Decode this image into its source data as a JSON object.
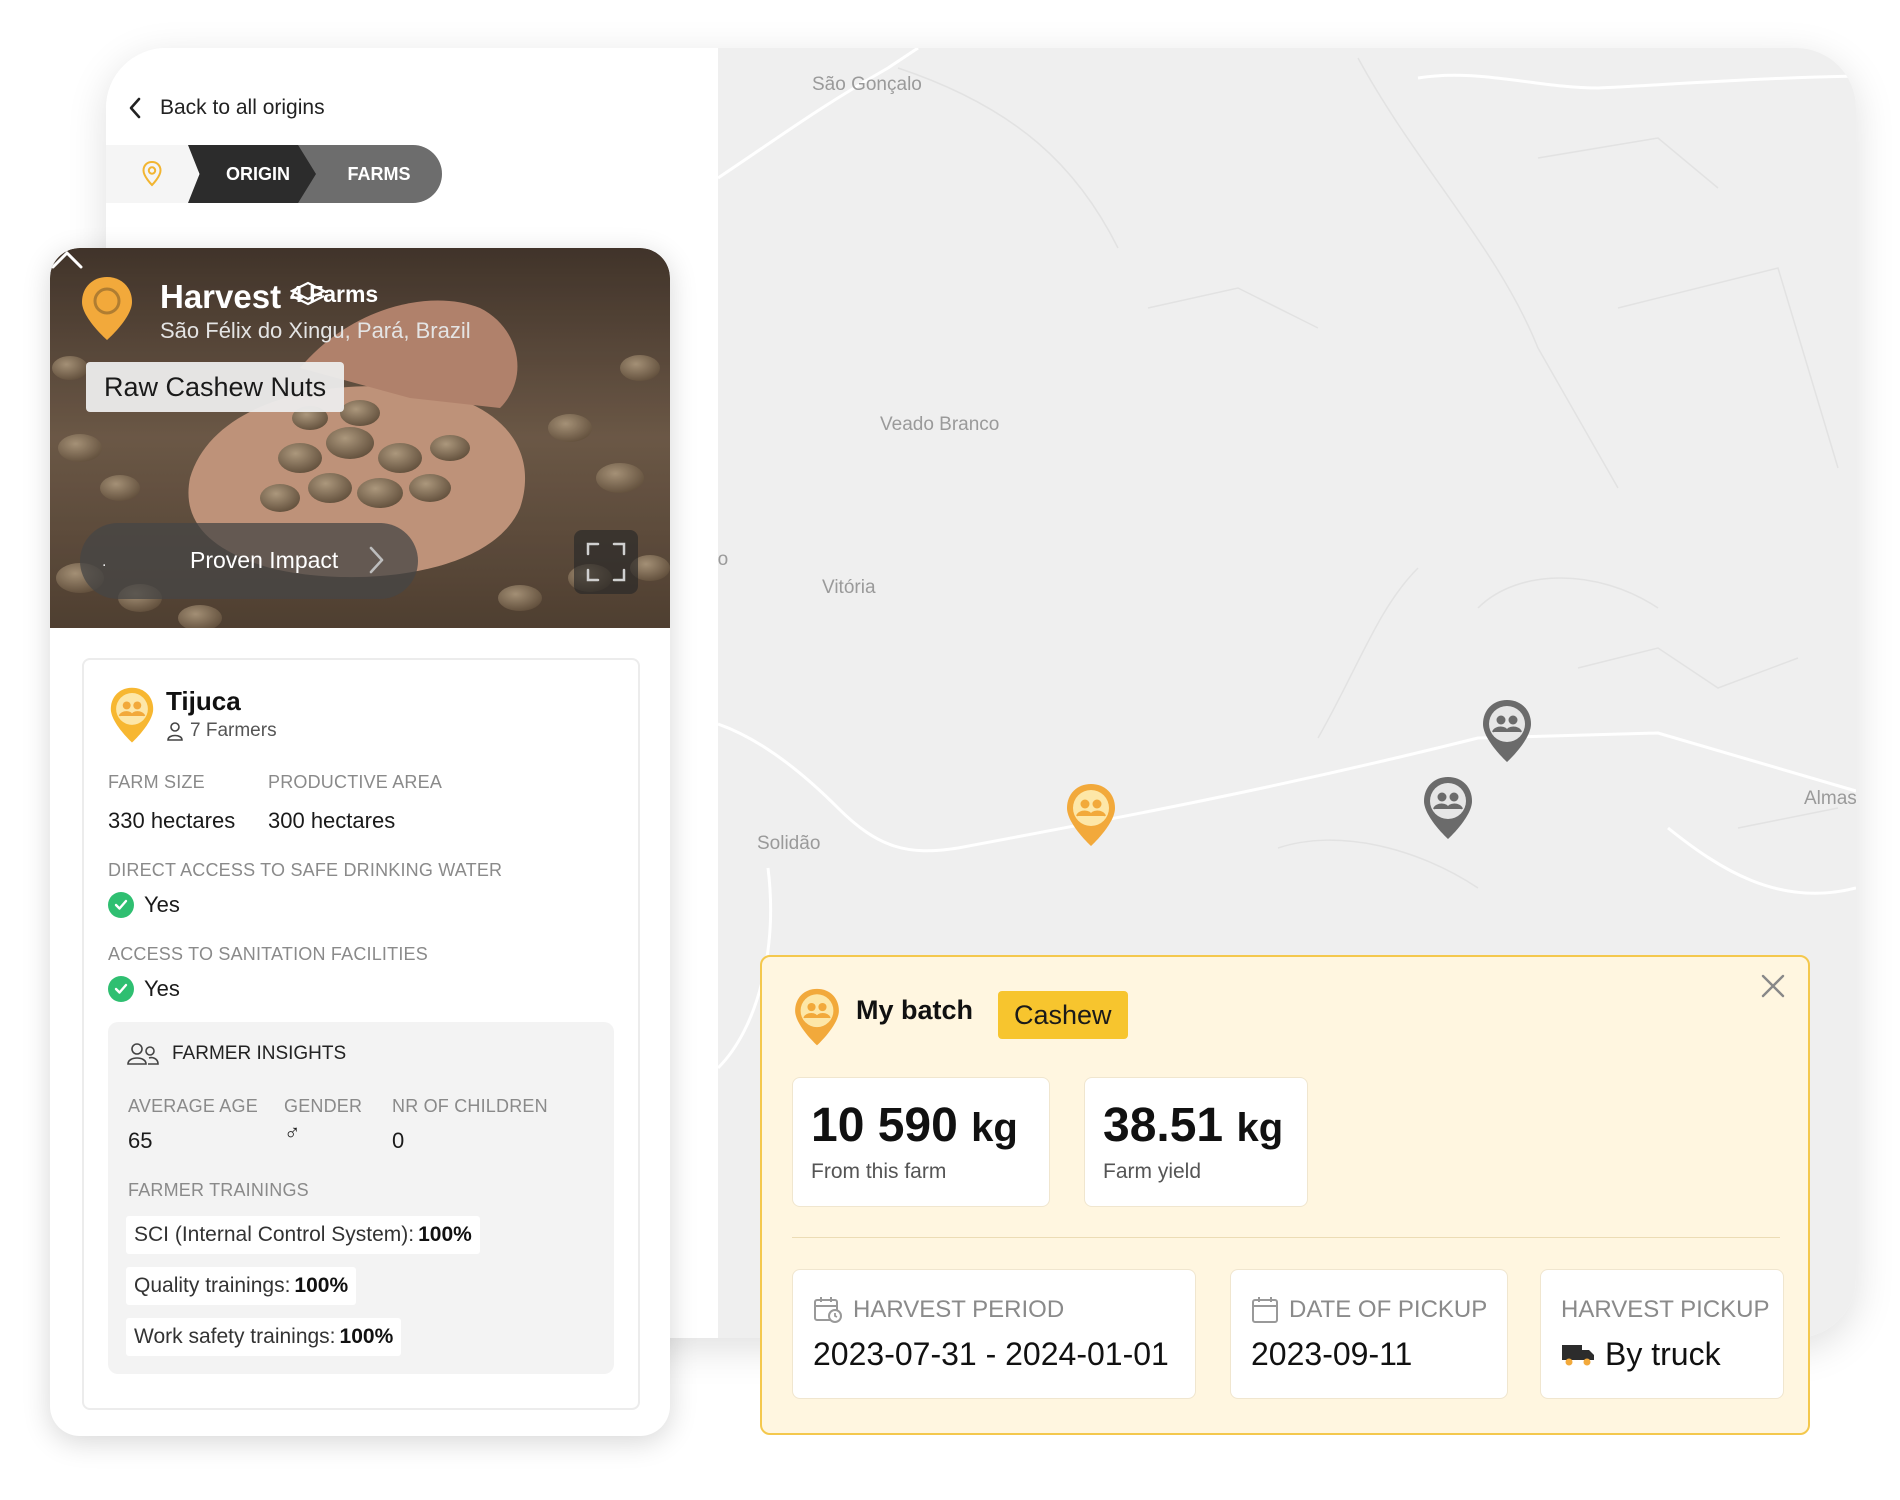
{
  "nav": {
    "back_label": "Back to all origins",
    "breadcrumbs": [
      {
        "label": "ORIGIN"
      },
      {
        "label": "FARMS"
      }
    ]
  },
  "map": {
    "places": [
      "São Gonçalo",
      "Veado Branco",
      "rto",
      "Vitória",
      "Solidão",
      "Almas"
    ]
  },
  "origin_card": {
    "title": "Harvest",
    "farms_count": "4 Farms",
    "location": "São Félix do Xingu, Pará, Brazil",
    "product": "Raw Cashew Nuts",
    "impact_dot": ".",
    "impact_label": "Proven Impact"
  },
  "farm": {
    "name": "Tijuca",
    "farmers": "7 Farmers",
    "farm_size_label": "FARM SIZE",
    "farm_size_value": "330 hectares",
    "productive_area_label": "PRODUCTIVE AREA",
    "productive_area_value": "300 hectares",
    "water_label": "DIRECT ACCESS TO SAFE DRINKING WATER",
    "water_value": "Yes",
    "sanitation_label": "ACCESS TO SANITATION FACILITIES",
    "sanitation_value": "Yes",
    "insights": {
      "title": "FARMER INSIGHTS",
      "age_label": "AVERAGE AGE",
      "age_value": "65",
      "gender_label": "GENDER",
      "gender_symbol": "♂",
      "children_label": "NR OF CHILDREN",
      "children_value": "0",
      "trainings_label": "FARMER TRAININGS",
      "trainings": [
        {
          "label": "SCI (Internal Control System):",
          "value": "100%"
        },
        {
          "label": "Quality trainings:",
          "value": "100%"
        },
        {
          "label": "Work safety trainings:",
          "value": "100%"
        }
      ]
    }
  },
  "batch": {
    "title": "My batch",
    "tag": "Cashew",
    "stats": [
      {
        "value": "10 590",
        "unit": "kg",
        "caption": "From this farm"
      },
      {
        "value": "38.51",
        "unit": "kg",
        "caption": "Farm yield"
      }
    ],
    "harvest_period_label": "HARVEST PERIOD",
    "harvest_period_value": "2023-07-31 - 2024-01-01",
    "pickup_date_label": "DATE OF PICKUP",
    "pickup_date_value": "2023-09-11",
    "pickup_label": "HARVEST PICKUP",
    "pickup_value": "By truck"
  },
  "colors": {
    "accent_yellow": "#f7c52e",
    "pin_orange": "#f2a93b",
    "pin_gray": "#6b6b6b",
    "check_green": "#2fbf71",
    "dark": "#2c2c2c"
  }
}
